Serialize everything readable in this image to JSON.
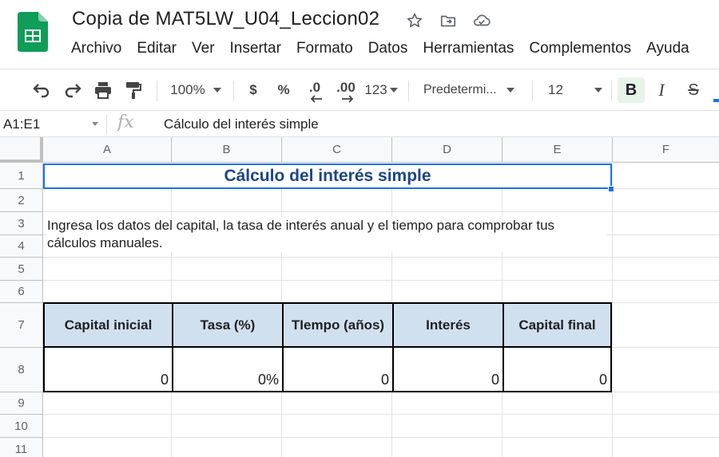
{
  "app": {
    "brand_color": "#0f9d58"
  },
  "document": {
    "title": "Copia de MAT5LW_U04_Leccion02"
  },
  "title_icons": [
    "star-icon",
    "move-to-folder-icon",
    "cloud-status-icon"
  ],
  "menu": [
    "Archivo",
    "Editar",
    "Ver",
    "Insertar",
    "Formato",
    "Datos",
    "Herramientas",
    "Complementos",
    "Ayuda"
  ],
  "toolbar": {
    "zoom": "100%",
    "currency": "$",
    "percent": "%",
    "decrease_decimals": ".0",
    "increase_decimals": ".00",
    "number_format": "123",
    "font": "Predetermi...",
    "font_size": "12",
    "bold": "B",
    "italic": "I",
    "strikethrough": "S"
  },
  "formula_bar": {
    "name_box": "A1:E1",
    "fx": "fx",
    "content": "Cálculo del interés simple"
  },
  "columns": [
    "A",
    "B",
    "C",
    "D",
    "E",
    "F"
  ],
  "rows": [
    "1",
    "2",
    "3",
    "4",
    "5",
    "6",
    "7",
    "8",
    "9",
    "10",
    "11"
  ],
  "sheet": {
    "title": "Cálculo del interés simple",
    "intro": "Ingresa los datos del capital, la tasa de interés anual y el tiempo para comprobar tus cálculos manuales.",
    "table_headers": [
      "Capital inicial",
      "Tasa (%)",
      "TIempo (años)",
      "Interés",
      "Capital final"
    ],
    "table_values": [
      "0",
      "0%",
      "0",
      "0",
      "0"
    ],
    "header_fill": "#d0e0ef",
    "title_color": "#1c4587"
  }
}
